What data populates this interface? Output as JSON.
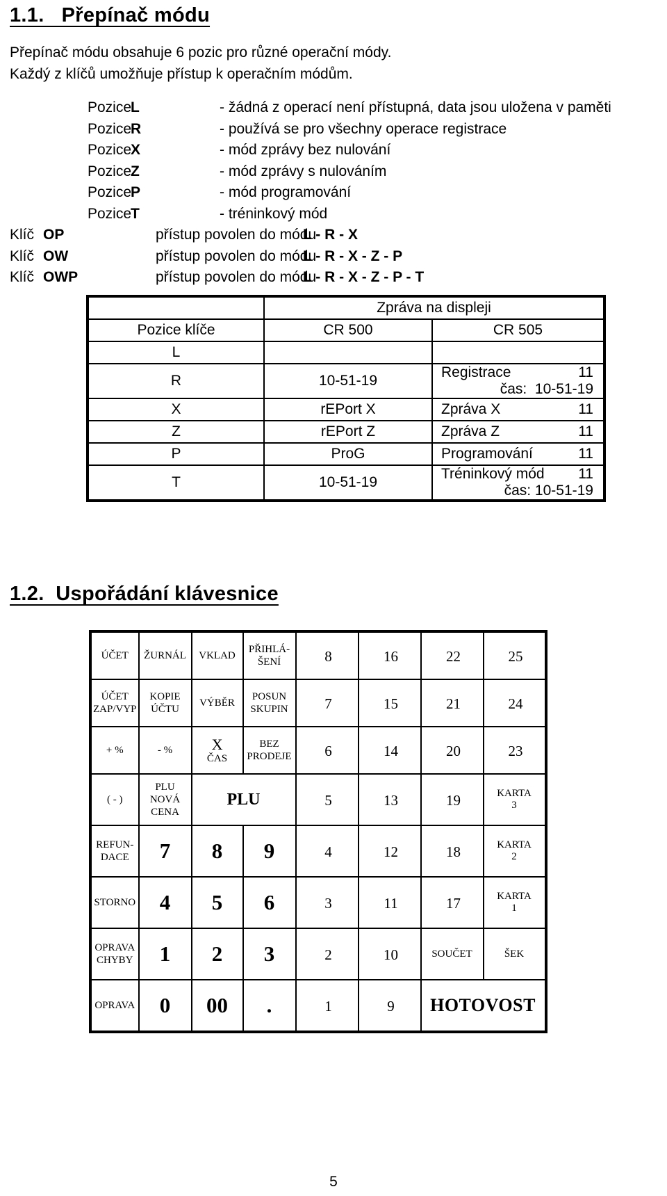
{
  "headings": {
    "s11": "1.1.   Přepínač módu",
    "s12": "1.2.  Uspořádání klávesnice"
  },
  "intro": {
    "line1": "Přepínač módu obsahuje 6 pozic pro různé operační módy.",
    "line2": "Každý z klíčů umožňuje přístup k operačním módům."
  },
  "pozice": {
    "label": "Pozice",
    "items": [
      {
        "code": "L",
        "desc": "- žádná z operací není přístupná, data jsou uložena v paměti"
      },
      {
        "code": "R",
        "desc": "- používá se pro všechny operace registrace"
      },
      {
        "code": "X",
        "desc": "- mód zprávy bez nulování"
      },
      {
        "code": "Z",
        "desc": "- mód zprávy s nulováním"
      },
      {
        "code": "P",
        "desc": "- mód programování"
      },
      {
        "code": "T",
        "desc": "- tréninkový mód"
      }
    ]
  },
  "klic": {
    "label": "Klíč",
    "access_text": "přístup povolen do módu",
    "items": [
      {
        "code": "OP",
        "modes": "L - R - X"
      },
      {
        "code": "OW",
        "modes": "L - R - X - Z - P"
      },
      {
        "code": "OWP",
        "modes": "L - R - X - Z - P - T"
      }
    ]
  },
  "msg_table": {
    "group_header": "Zpráva na displeji",
    "col_key": "Pozice klíče",
    "col_cr500": "CR 500",
    "col_cr505": "CR 505",
    "rows": [
      {
        "key": "L",
        "cr500": "",
        "cr505": "",
        "cr505_num": "",
        "cr505_line2": ""
      },
      {
        "key": "R",
        "cr500": "10-51-19",
        "cr505": "Registrace",
        "cr505_num": "11",
        "cr505_line2": "čas:  10-51-19"
      },
      {
        "key": "X",
        "cr500": "rEPort  X",
        "cr505": "Zpráva X",
        "cr505_num": "11",
        "cr505_line2": ""
      },
      {
        "key": "Z",
        "cr500": "rEPort  Z",
        "cr505": "Zpráva Z",
        "cr505_num": "11",
        "cr505_line2": ""
      },
      {
        "key": "P",
        "cr500": "ProG",
        "cr505": "Programování",
        "cr505_num": "11",
        "cr505_line2": ""
      },
      {
        "key": "T",
        "cr500": "10-51-19",
        "cr505": "Tréninkový mód",
        "cr505_num": "11",
        "cr505_line2": "čas: 10-51-19"
      }
    ]
  },
  "keyboard": {
    "r1": {
      "ucet": "ÚČET",
      "zurnal": "ŽURNÁL",
      "vklad": "VKLAD",
      "prihlaseni_1": "PŘIHLÁ-",
      "prihlaseni_2": "ŠENÍ",
      "n8": "8",
      "n16": "16",
      "n22": "22",
      "n25": "25"
    },
    "r2": {
      "ucet_1": "ÚČET",
      "ucet_2": "ZAP/VYP",
      "kopie_1": "KOPIE",
      "kopie_2": "ÚČTU",
      "vyber": "VÝBĚR",
      "posun_1": "POSUN",
      "posun_2": "SKUPIN",
      "n7": "7",
      "n15": "15",
      "n21": "21",
      "n24": "24"
    },
    "r3": {
      "plus": "+ %",
      "minus": "- %",
      "x": "X",
      "cas": "ČAS",
      "bez_1": "BEZ",
      "bez_2": "PRODEJE",
      "n6": "6",
      "n14": "14",
      "n20": "20",
      "n23": "23"
    },
    "r4": {
      "minus_paren": "( - )",
      "plu_1": "PLU",
      "plu_2": "NOVÁ",
      "plu_3": "CENA",
      "plu_big": "PLU",
      "n5": "5",
      "n13": "13",
      "n19": "19",
      "karta": "KARTA",
      "karta_num": "3"
    },
    "r5": {
      "refun_1": "REFUN-",
      "refun_2": "DACE",
      "k7": "7",
      "k8": "8",
      "k9": "9",
      "n4": "4",
      "n12": "12",
      "n18": "18",
      "karta": "KARTA",
      "karta_num": "2"
    },
    "r6": {
      "storno": "STORNO",
      "k4": "4",
      "k5": "5",
      "k6": "6",
      "n3": "3",
      "n11": "11",
      "n17": "17",
      "karta": "KARTA",
      "karta_num": "1"
    },
    "r7": {
      "oprava_1": "OPRAVA",
      "oprava_2": "CHYBY",
      "k1": "1",
      "k2": "2",
      "k3": "3",
      "n2": "2",
      "n10": "10",
      "soucet": "SOUČET",
      "sek": "ŠEK"
    },
    "r8": {
      "oprava": "OPRAVA",
      "k0": "0",
      "k00": "00",
      "kdot": ".",
      "n1": "1",
      "n9": "9",
      "hotovost": "HOTOVOST"
    }
  },
  "footer": {
    "page_number": "5"
  }
}
